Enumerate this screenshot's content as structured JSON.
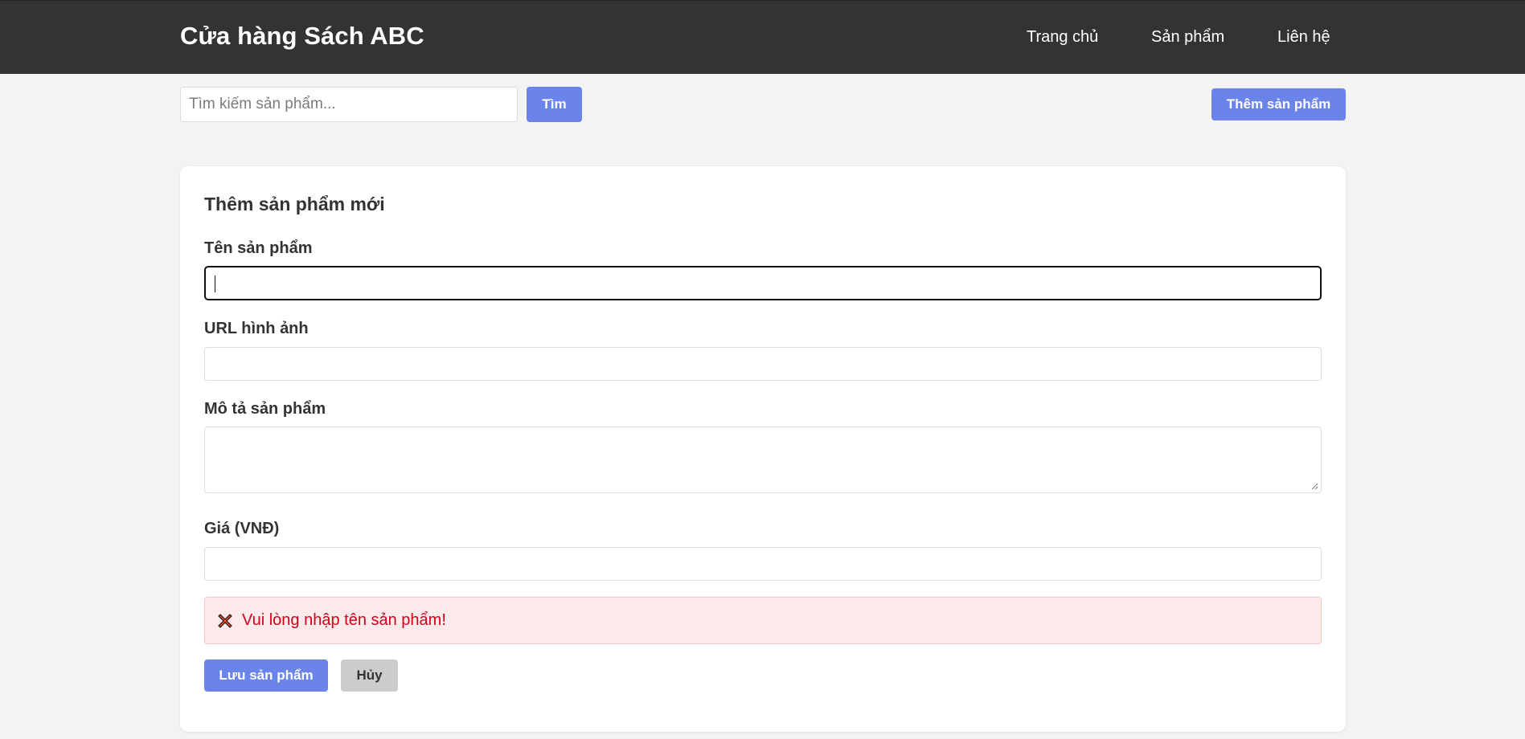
{
  "header": {
    "brand": "Cửa hàng Sách ABC",
    "nav": {
      "home": "Trang chủ",
      "products": "Sản phẩm",
      "contact": "Liên hệ"
    }
  },
  "toolbar": {
    "search_placeholder": "Tìm kiếm sản phẩm...",
    "search_value": "",
    "search_button": "Tìm",
    "add_product_button": "Thêm sản phẩm"
  },
  "form": {
    "title": "Thêm sản phẩm mới",
    "fields": {
      "name": {
        "label": "Tên sản phẩm",
        "value": ""
      },
      "image_url": {
        "label": "URL hình ảnh",
        "value": ""
      },
      "description": {
        "label": "Mô tả sản phẩm",
        "value": ""
      },
      "price": {
        "label": "Giá (VNĐ)",
        "value": ""
      }
    },
    "error": {
      "icon": "cross-mark-icon",
      "message": "Vui lòng nhập tên sản phẩm!"
    },
    "save_button": "Lưu sản phẩm",
    "cancel_button": "Hủy"
  },
  "colors": {
    "header_bg": "#333333",
    "primary": "#6b84ea",
    "error_text": "#d0021b",
    "error_bg": "#fdebec",
    "cancel_bg": "#cccccc",
    "page_bg": "#f3f3f4"
  }
}
